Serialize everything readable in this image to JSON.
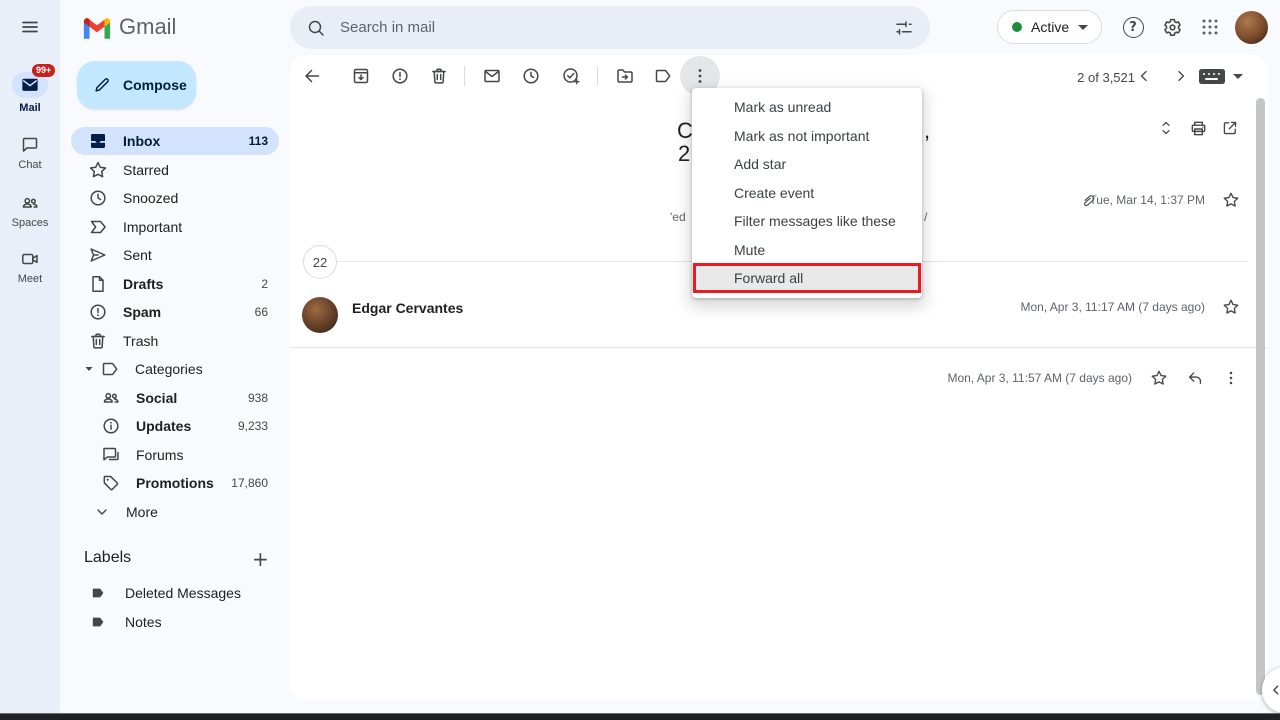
{
  "brand": {
    "name": "Gmail"
  },
  "rail": {
    "items": [
      {
        "label": "Mail",
        "badge": "99+"
      },
      {
        "label": "Chat"
      },
      {
        "label": "Spaces"
      },
      {
        "label": "Meet"
      }
    ]
  },
  "search": {
    "placeholder": "Search in mail"
  },
  "account": {
    "status_label": "Active"
  },
  "sidebar": {
    "compose_label": "Compose",
    "items": [
      {
        "label": "Inbox",
        "count": "113"
      },
      {
        "label": "Starred",
        "count": ""
      },
      {
        "label": "Snoozed",
        "count": ""
      },
      {
        "label": "Important",
        "count": ""
      },
      {
        "label": "Sent",
        "count": ""
      },
      {
        "label": "Drafts",
        "count": "2"
      },
      {
        "label": "Spam",
        "count": "66"
      },
      {
        "label": "Trash",
        "count": ""
      },
      {
        "label": "Categories",
        "count": ""
      },
      {
        "label": "Social",
        "count": "938"
      },
      {
        "label": "Updates",
        "count": "9,233"
      },
      {
        "label": "Forums",
        "count": ""
      },
      {
        "label": "Promotions",
        "count": "17,860"
      },
      {
        "label": "More",
        "count": ""
      }
    ],
    "labels_section": {
      "title": "Labels",
      "items": [
        {
          "label": "Deleted Messages"
        },
        {
          "label": "Notes"
        }
      ]
    }
  },
  "toolbar": {
    "pagination": "2 of 3,521"
  },
  "menu": {
    "items": [
      {
        "label": "Mark as unread"
      },
      {
        "label": "Mark as not important"
      },
      {
        "label": "Add star"
      },
      {
        "label": "Create event"
      },
      {
        "label": "Filter messages like these"
      },
      {
        "label": "Mute"
      },
      {
        "label": "Forward all",
        "highlighted": true
      }
    ]
  },
  "thread": {
    "subject_fragment_line1_left": "C",
    "subject_fragment_line1_right": ",",
    "subject_fragment_line2": "2",
    "meta_fragment_left": "'ed",
    "meta_fragment_right": "/",
    "message1_date": "Tue, Mar 14, 1:37 PM",
    "collapsed_count": "22",
    "message2_sender": "Edgar Cervantes",
    "message2_date": "Mon, Apr 3, 11:17 AM (7 days ago)",
    "message3_date": "Mon, Apr 3, 11:57 AM (7 days ago)"
  },
  "glyphs": {
    "help": "?",
    "plus": "+"
  },
  "colors": {
    "compose_blue": "#c2e7ff",
    "selected_pill_blue": "#d3e3fd",
    "badge_red": "#c5221f",
    "annotation_red": "#ea1b22",
    "active_status_green": "#1e8e3e"
  }
}
